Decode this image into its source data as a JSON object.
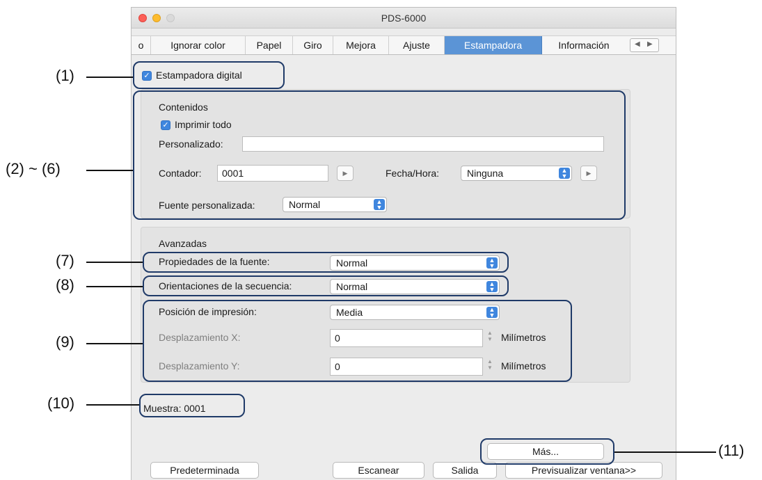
{
  "window": {
    "title": "PDS-6000"
  },
  "tabs": [
    {
      "label": "o"
    },
    {
      "label": "Ignorar color"
    },
    {
      "label": "Papel"
    },
    {
      "label": "Giro"
    },
    {
      "label": "Mejora"
    },
    {
      "label": "Ajuste"
    },
    {
      "label": "Estampadora",
      "active": true
    },
    {
      "label": "Información"
    }
  ],
  "tab_scroll": {
    "left": "◀",
    "right": "▶"
  },
  "digital_imprinter": {
    "label": "Estampadora digital",
    "checked": true
  },
  "contents": {
    "heading": "Contenidos",
    "print_all_label": "Imprimir todo",
    "print_all_checked": true,
    "custom_label": "Personalizado:",
    "custom_value": "",
    "counter_label": "Contador:",
    "counter_value": "0001",
    "datetime_label": "Fecha/Hora:",
    "datetime_value": "Ninguna",
    "custom_font_label": "Fuente personalizada:",
    "custom_font_value": "Normal"
  },
  "advanced": {
    "heading": "Avanzadas",
    "font_props_label": "Propiedades de la fuente:",
    "font_props_value": "Normal",
    "sequence_label": "Orientaciones de la secuencia:",
    "sequence_value": "Normal",
    "print_pos_label": "Posición de impresión:",
    "print_pos_value": "Media",
    "offset_x_label": "Desplazamiento X:",
    "offset_x_value": "0",
    "offset_y_label": "Desplazamiento Y:",
    "offset_y_value": "0",
    "unit": "Milímetros"
  },
  "sample": {
    "label": "Muestra:",
    "value": "0001"
  },
  "buttons": {
    "more": "Más...",
    "default": "Predeterminada",
    "scan": "Escanear",
    "exit": "Salida",
    "preview": "Previsualizar ventana>>"
  },
  "annotations": [
    "(1)",
    "(2) ~ (6)",
    "(7)",
    "(8)",
    "(9)",
    "(10)",
    "(11)"
  ],
  "colors": {
    "accent": "#3f86de",
    "callout": "#1f3a68",
    "active_tab": "#5b94d6"
  },
  "icons": {
    "checkbox": "checkmark-icon",
    "popup": "updown-chevron-icon",
    "arrow": "play-arrow-icon"
  }
}
